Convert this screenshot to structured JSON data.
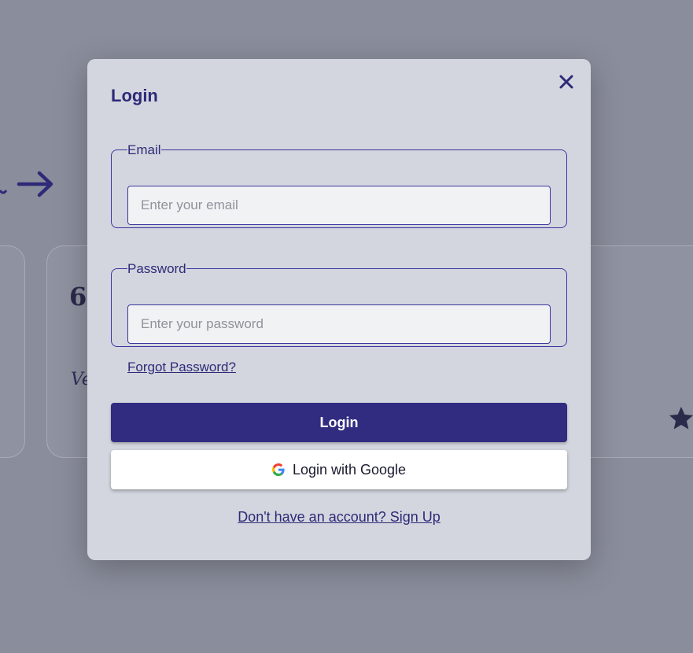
{
  "background": {
    "quote_glyph": "6",
    "card_text_fragment": "Ve"
  },
  "modal": {
    "title": "Login",
    "email": {
      "label": "Email",
      "placeholder": "Enter your email",
      "value": ""
    },
    "password": {
      "label": "Password",
      "placeholder": "Enter your password",
      "value": ""
    },
    "forgot_label": "Forgot Password?",
    "login_button": "Login",
    "google_button": "Login with Google",
    "signup_link": "Don't have an account? Sign Up"
  },
  "icons": {
    "close": "close-icon",
    "google": "google-g-icon",
    "arrow": "arrow-right-icon",
    "star": "star-icon"
  },
  "colors": {
    "accent": "#312c80",
    "text_accent": "#2e2a78",
    "modal_bg": "#d3d6de",
    "overlay_bg": "#8a8d9b"
  }
}
